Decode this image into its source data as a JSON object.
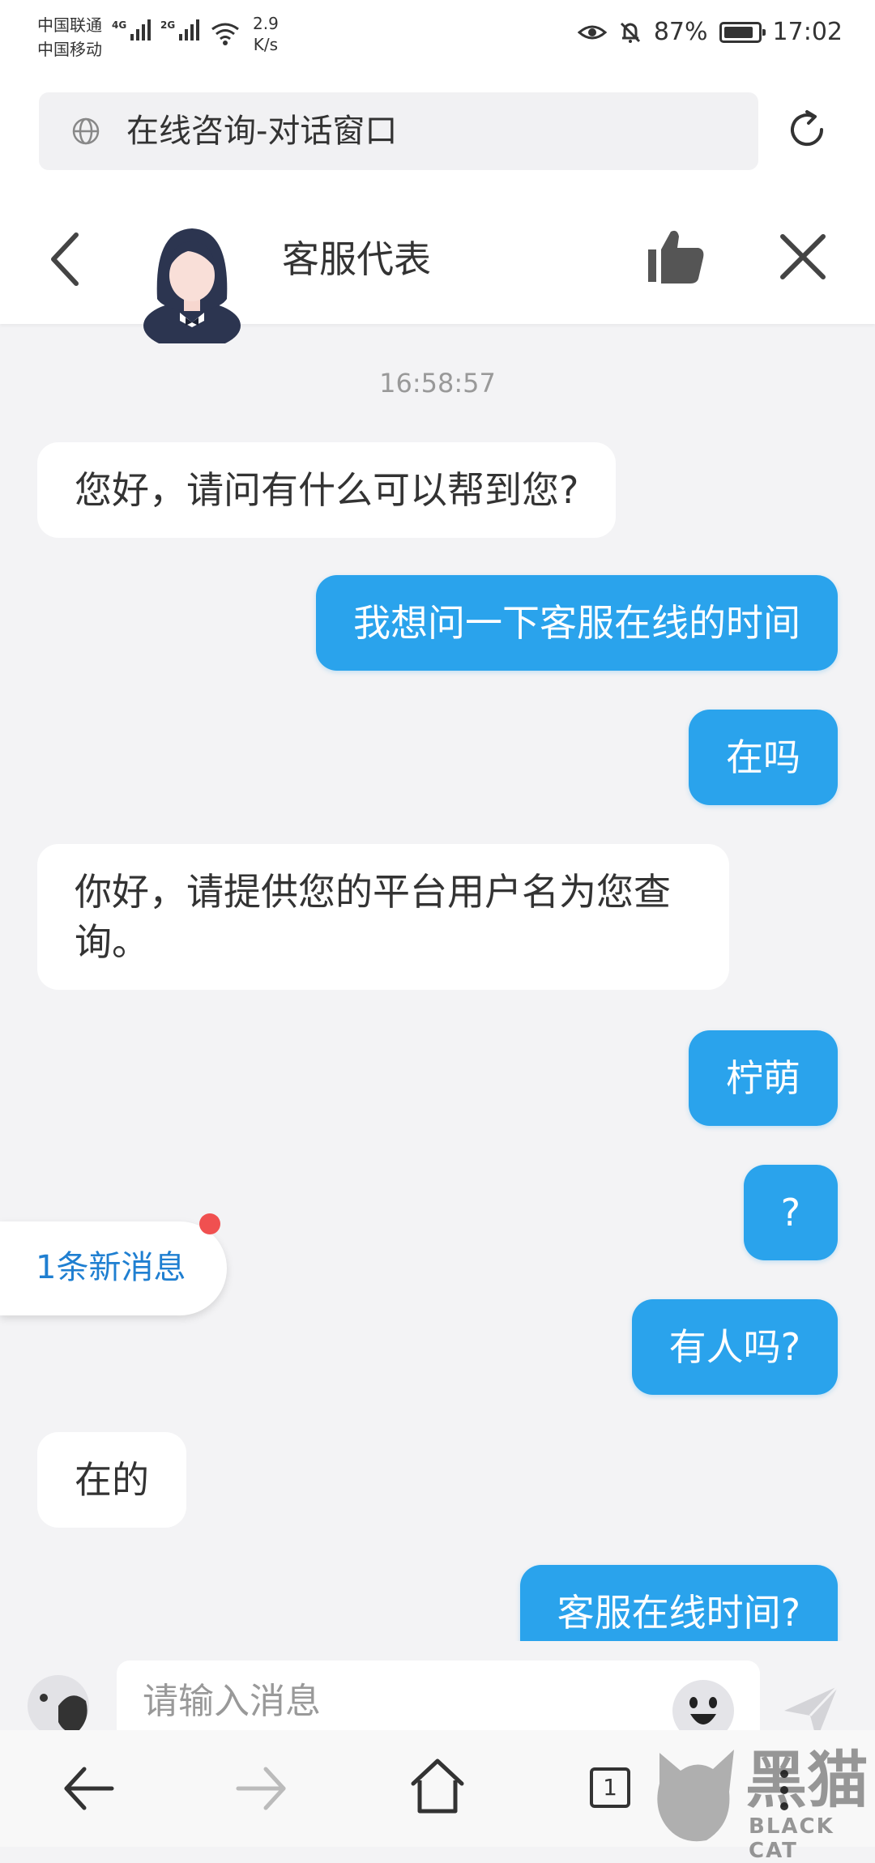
{
  "status_bar": {
    "carrier_1": "中国联通",
    "carrier_2": "中国移动",
    "network_1": "4G",
    "network_2": "2G",
    "speed_value": "2.9",
    "speed_unit": "K/s",
    "battery": "87%",
    "battery_level": 0.87,
    "time": "17:02"
  },
  "browser": {
    "url_title": "在线咨询-对话窗口"
  },
  "chat_header": {
    "agent_name": "客服代表"
  },
  "chat": {
    "timestamp": "16:58:57",
    "messages": [
      {
        "side": "left",
        "text": "您好，请问有什么可以帮到您?"
      },
      {
        "side": "right",
        "text": "我想问一下客服在线的时间"
      },
      {
        "side": "right",
        "text": "在吗"
      },
      {
        "side": "left",
        "text": "你好，请提供您的平台用户名为您查询。"
      },
      {
        "side": "right",
        "text": "柠萌"
      },
      {
        "side": "right",
        "text": "?"
      },
      {
        "side": "right",
        "text": "有人吗?"
      },
      {
        "side": "left",
        "text": "在的"
      },
      {
        "side": "right",
        "text": "客服在线时间?"
      }
    ],
    "new_message_badge": "1条新消息"
  },
  "input": {
    "placeholder": "请输入消息"
  },
  "nav": {
    "tab_count": "1"
  },
  "watermark": {
    "text": "黑猫",
    "sub": "BLACK CAT"
  },
  "colors": {
    "accent": "#2aa3ec",
    "badge": "#f05050",
    "background": "#f3f3f5"
  }
}
